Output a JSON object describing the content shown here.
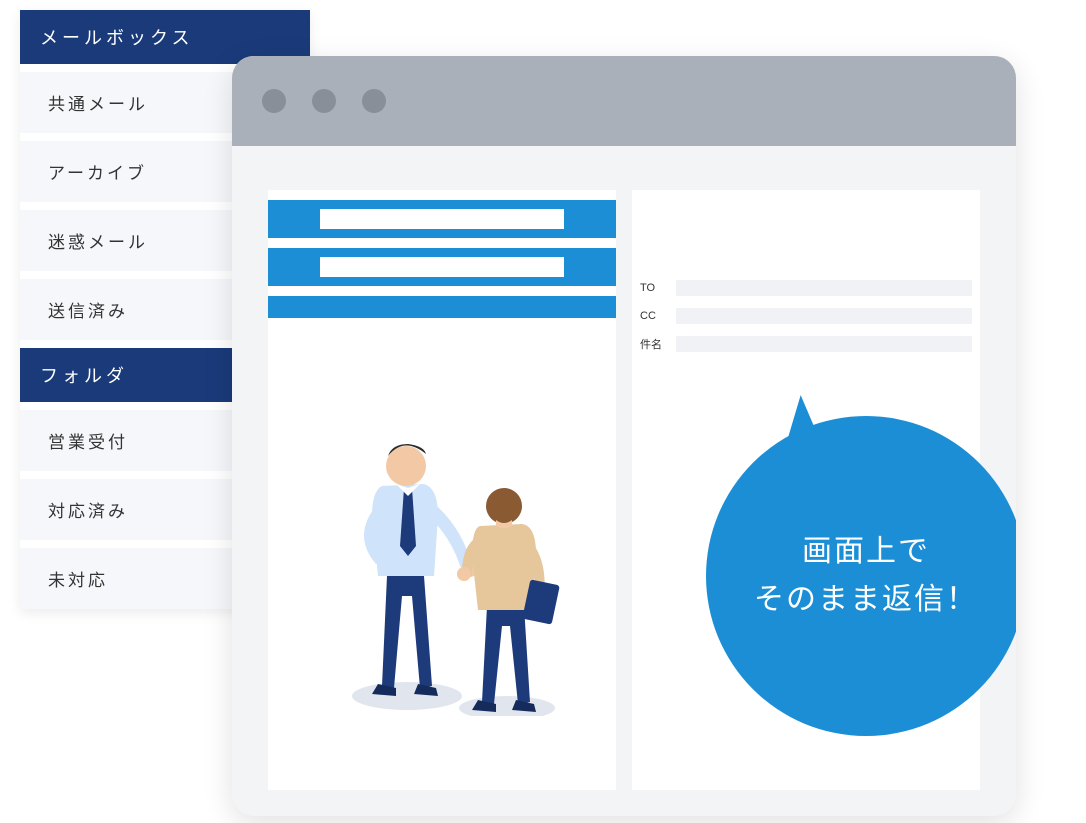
{
  "sidebar": {
    "section1_header": "メールボックス",
    "section1_items": [
      "共通メール",
      "アーカイブ",
      "迷惑メール",
      "送信済み"
    ],
    "section2_header": "フォルダ",
    "section2_items": [
      "営業受付",
      "対応済み",
      "未対応"
    ]
  },
  "compose": {
    "to_label": "TO",
    "cc_label": "CC",
    "subject_label": "件名"
  },
  "bubble": {
    "line1": "画面上で",
    "line2": "そのまま返信！"
  }
}
